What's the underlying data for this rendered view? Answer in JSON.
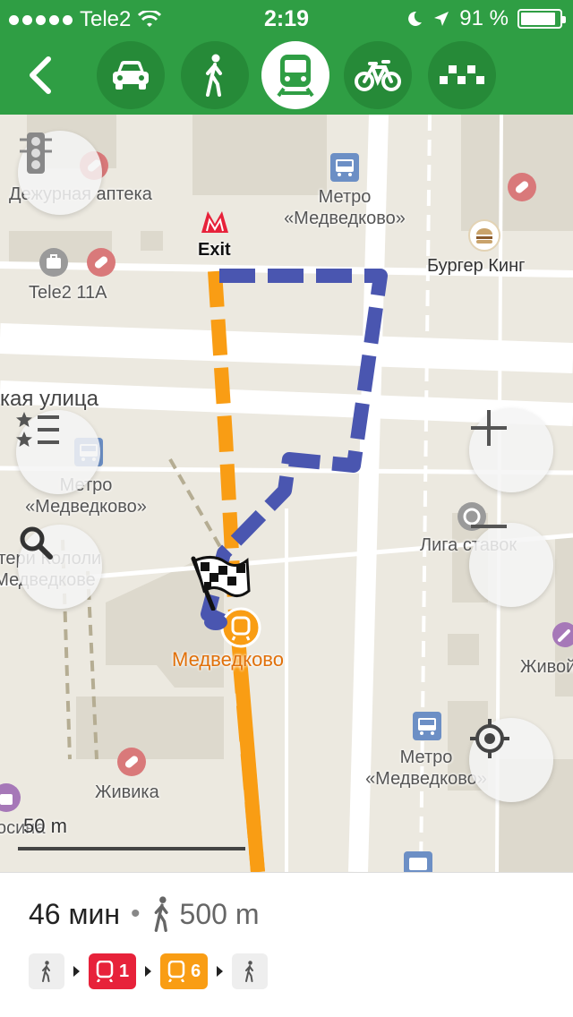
{
  "status_bar": {
    "carrier": "Tele2",
    "time": "2:19",
    "battery_percent": "91 %",
    "battery_level": 0.91
  },
  "toolbar": {
    "modes": [
      {
        "name": "car",
        "icon": "car-icon",
        "active": false
      },
      {
        "name": "walk",
        "icon": "walking-person-icon",
        "active": false
      },
      {
        "name": "transit",
        "icon": "train-icon",
        "active": true
      },
      {
        "name": "bike",
        "icon": "bicycle-icon",
        "active": false
      },
      {
        "name": "taxi",
        "icon": "taxi-checker-icon",
        "active": false
      }
    ]
  },
  "map": {
    "pois": {
      "pharmacy": "Дежурная аптека",
      "metro_top": [
        "Метро",
        "«Медведково»"
      ],
      "metro_exit": "Exit",
      "burger": "Бургер Кинг",
      "tele2": "Tele2 11А",
      "street": "кая улица",
      "metro_mid": [
        "Метро",
        "«Медведково»"
      ],
      "partial_left": [
        "атери Кололи",
        "Медведкове"
      ],
      "liga": "Лига ставок",
      "station": "Медведково",
      "zhivoy": "Живой",
      "metro_bottom": [
        "Метро",
        "«Медведково»"
      ],
      "zhivika": "Живика",
      "partial_bottom_left": "осина"
    },
    "scale": "50 m",
    "colors": {
      "route_walk": "#4a56b0",
      "route_metro": "#f99d14",
      "station_label": "#e0700a"
    }
  },
  "summary": {
    "duration": "46 мин",
    "walk_distance": "500 m"
  },
  "steps": [
    {
      "type": "walk"
    },
    {
      "type": "metro",
      "line": "1",
      "color": "#e7223a"
    },
    {
      "type": "metro",
      "line": "6",
      "color": "#f99d14"
    },
    {
      "type": "walk"
    }
  ]
}
